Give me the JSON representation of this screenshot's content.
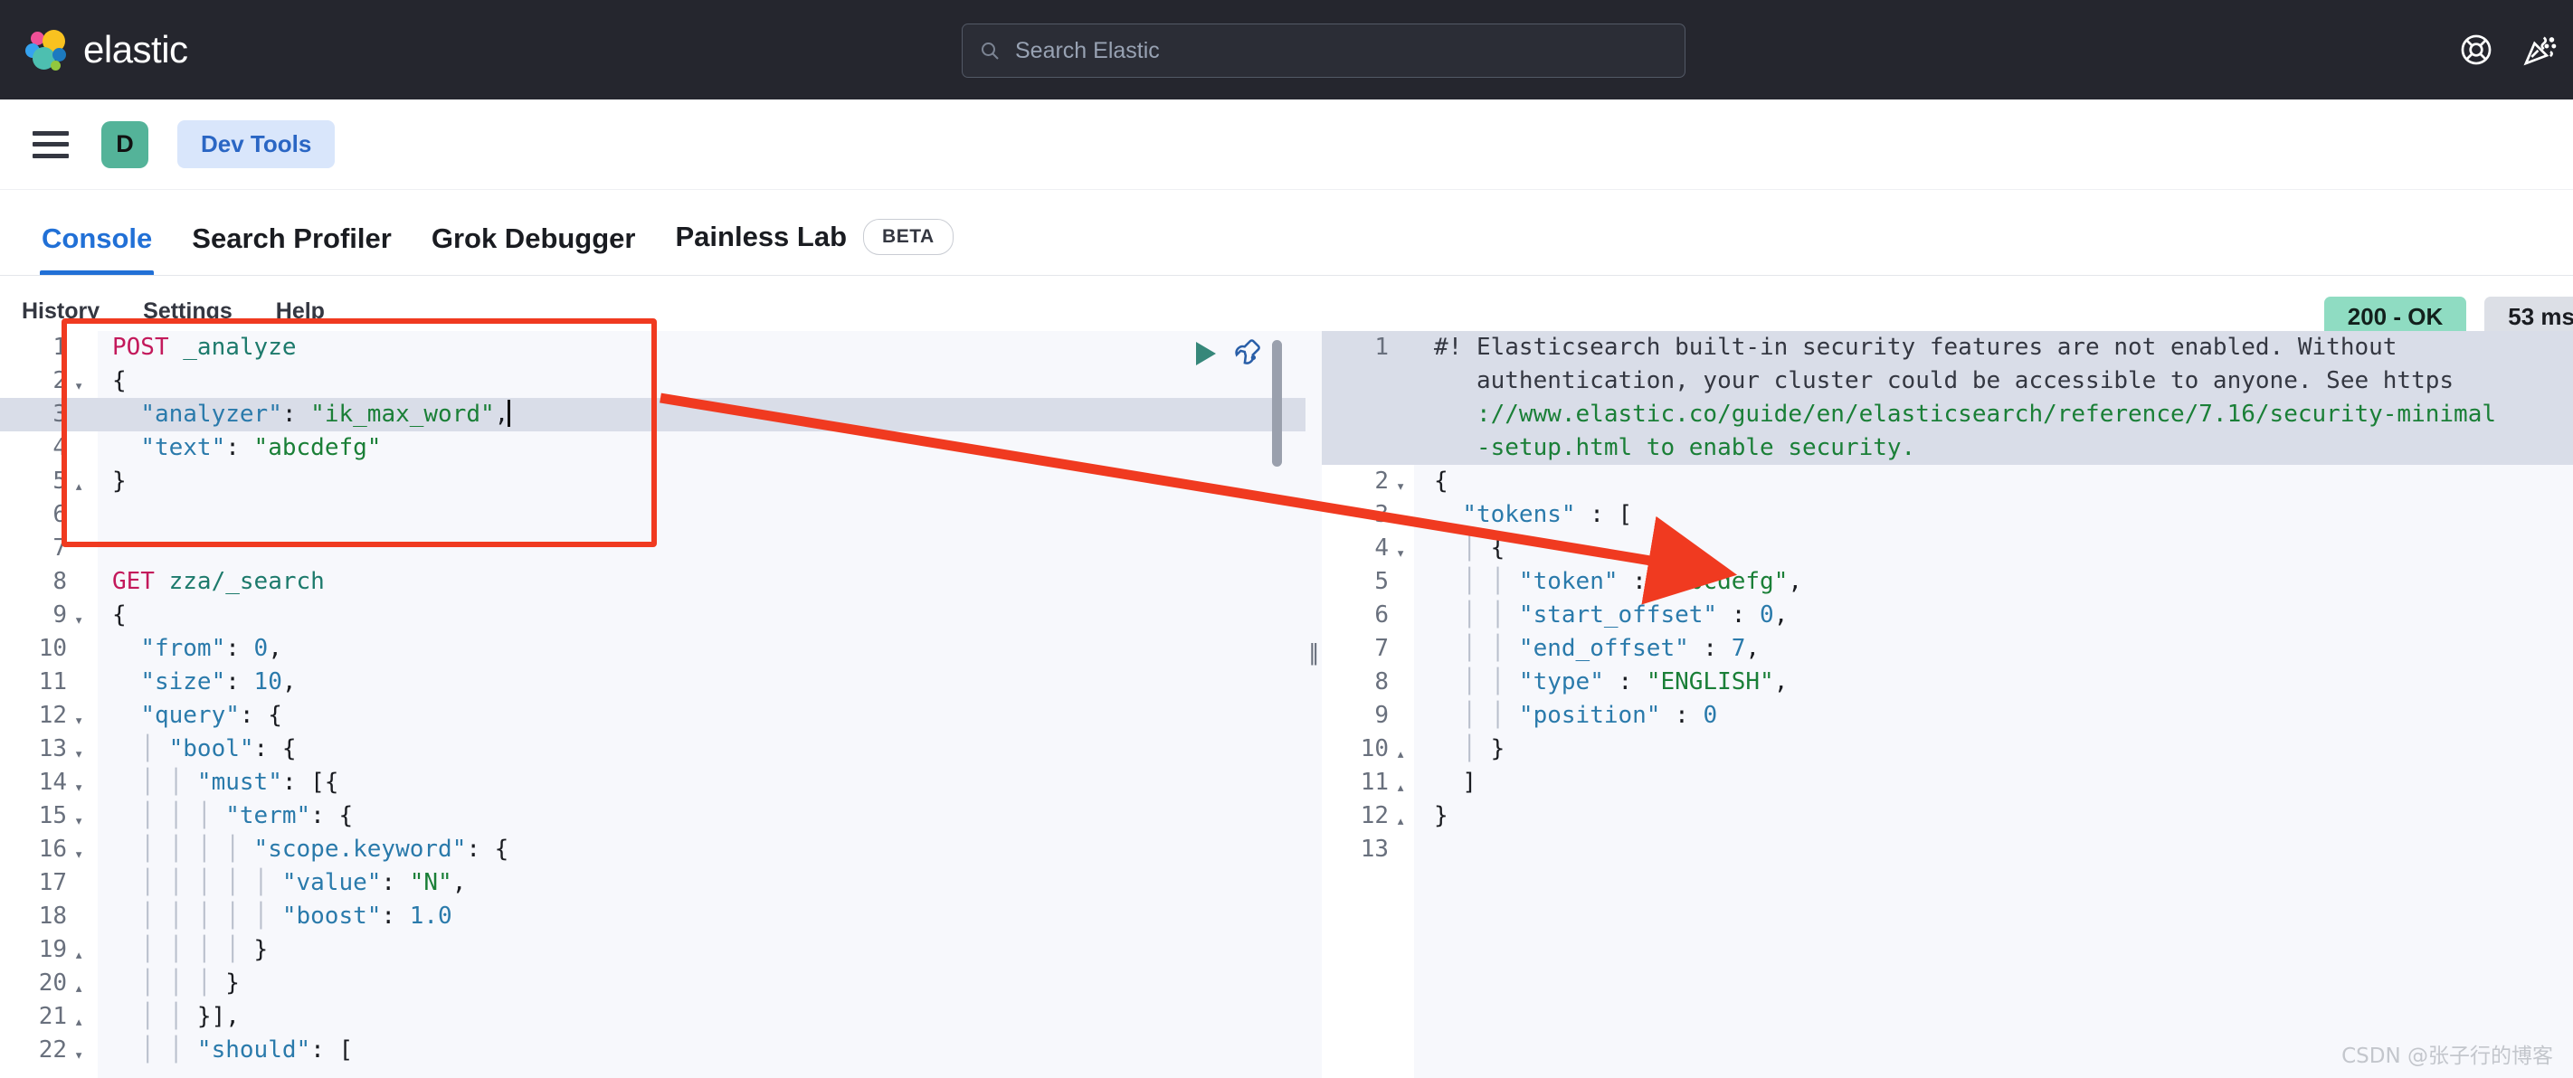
{
  "header": {
    "brand": "elastic",
    "logo_colors": {
      "pink": "#ee5097",
      "yellow": "#f9c220",
      "blue": "#36a2ef",
      "teal": "#4dbfb0",
      "navy": "#1c7ac0",
      "green": "#92c73e"
    },
    "background": "#25262e",
    "search_placeholder": "Search Elastic",
    "icons": [
      "help-lifebuoy-icon",
      "news-confetti-icon"
    ]
  },
  "breadcrumb": {
    "menu_icon": "hamburger-menu-icon",
    "space_initial": "D",
    "space_color": "#54b399",
    "crumb_label": "Dev Tools",
    "crumb_color": "#2a66c4"
  },
  "tabs": [
    {
      "label": "Console",
      "active": true
    },
    {
      "label": "Search Profiler",
      "active": false
    },
    {
      "label": "Grok Debugger",
      "active": false
    },
    {
      "label": "Painless Lab",
      "active": false,
      "badge": "BETA"
    }
  ],
  "console_menu": [
    {
      "label": "History"
    },
    {
      "label": "Settings"
    },
    {
      "label": "Help"
    }
  ],
  "status": {
    "code_label": "200 - OK",
    "code_color": "#8fdcc2",
    "time_label": "53 ms",
    "time_color": "#dcdfe6"
  },
  "actions": {
    "play_label": "play-request-button",
    "wrench_label": "wrench-actions-button"
  },
  "request_editor": {
    "lines": [
      {
        "n": "1",
        "fold": "",
        "highlight": false,
        "parts": [
          {
            "t": "POST ",
            "c": "tok-method"
          },
          {
            "t": "_analyze",
            "c": "tok-url"
          }
        ]
      },
      {
        "n": "2",
        "fold": "▾",
        "highlight": false,
        "parts": [
          {
            "t": "{",
            "c": "tok-punct"
          }
        ]
      },
      {
        "n": "3",
        "fold": "",
        "highlight": true,
        "caret": true,
        "parts": [
          {
            "t": "  ",
            "c": "tok-punct"
          },
          {
            "t": "\"analyzer\"",
            "c": "tok-key"
          },
          {
            "t": ": ",
            "c": "tok-punct"
          },
          {
            "t": "\"ik_max_word\"",
            "c": "tok-str"
          },
          {
            "t": ",",
            "c": "tok-punct"
          }
        ]
      },
      {
        "n": "4",
        "fold": "",
        "highlight": false,
        "parts": [
          {
            "t": "  ",
            "c": "tok-punct"
          },
          {
            "t": "\"text\"",
            "c": "tok-key"
          },
          {
            "t": ": ",
            "c": "tok-punct"
          },
          {
            "t": "\"abcdefg\"",
            "c": "tok-str"
          }
        ]
      },
      {
        "n": "5",
        "fold": "▴",
        "highlight": false,
        "parts": [
          {
            "t": "}",
            "c": "tok-punct"
          }
        ]
      },
      {
        "n": "6",
        "fold": "",
        "highlight": false,
        "parts": []
      },
      {
        "n": "7",
        "fold": "",
        "highlight": false,
        "parts": []
      },
      {
        "n": "8",
        "fold": "",
        "highlight": false,
        "parts": [
          {
            "t": "GET ",
            "c": "tok-method"
          },
          {
            "t": "zza/_search",
            "c": "tok-url"
          }
        ]
      },
      {
        "n": "9",
        "fold": "▾",
        "highlight": false,
        "parts": [
          {
            "t": "{",
            "c": "tok-punct"
          }
        ]
      },
      {
        "n": "10",
        "fold": "",
        "highlight": false,
        "parts": [
          {
            "t": "  ",
            "c": "tok-punct"
          },
          {
            "t": "\"from\"",
            "c": "tok-key"
          },
          {
            "t": ": ",
            "c": "tok-punct"
          },
          {
            "t": "0",
            "c": "tok-num"
          },
          {
            "t": ",",
            "c": "tok-punct"
          }
        ]
      },
      {
        "n": "11",
        "fold": "",
        "highlight": false,
        "parts": [
          {
            "t": "  ",
            "c": "tok-punct"
          },
          {
            "t": "\"size\"",
            "c": "tok-key"
          },
          {
            "t": ": ",
            "c": "tok-punct"
          },
          {
            "t": "10",
            "c": "tok-num"
          },
          {
            "t": ",",
            "c": "tok-punct"
          }
        ]
      },
      {
        "n": "12",
        "fold": "▾",
        "highlight": false,
        "parts": [
          {
            "t": "  ",
            "c": "tok-punct"
          },
          {
            "t": "\"query\"",
            "c": "tok-key"
          },
          {
            "t": ": {",
            "c": "tok-punct"
          }
        ]
      },
      {
        "n": "13",
        "fold": "▾",
        "highlight": false,
        "parts": [
          {
            "t": "  │ ",
            "c": "indent-guide"
          },
          {
            "t": "\"bool\"",
            "c": "tok-key"
          },
          {
            "t": ": {",
            "c": "tok-punct"
          }
        ]
      },
      {
        "n": "14",
        "fold": "▾",
        "highlight": false,
        "parts": [
          {
            "t": "  │ │ ",
            "c": "indent-guide"
          },
          {
            "t": "\"must\"",
            "c": "tok-key"
          },
          {
            "t": ": [{",
            "c": "tok-punct"
          }
        ]
      },
      {
        "n": "15",
        "fold": "▾",
        "highlight": false,
        "parts": [
          {
            "t": "  │ │ │ ",
            "c": "indent-guide"
          },
          {
            "t": "\"term\"",
            "c": "tok-key"
          },
          {
            "t": ": {",
            "c": "tok-punct"
          }
        ]
      },
      {
        "n": "16",
        "fold": "▾",
        "highlight": false,
        "parts": [
          {
            "t": "  │ │ │ │ ",
            "c": "indent-guide"
          },
          {
            "t": "\"scope.keyword\"",
            "c": "tok-key"
          },
          {
            "t": ": {",
            "c": "tok-punct"
          }
        ]
      },
      {
        "n": "17",
        "fold": "",
        "highlight": false,
        "parts": [
          {
            "t": "  │ │ │ │ │ ",
            "c": "indent-guide"
          },
          {
            "t": "\"value\"",
            "c": "tok-key"
          },
          {
            "t": ": ",
            "c": "tok-punct"
          },
          {
            "t": "\"N\"",
            "c": "tok-str"
          },
          {
            "t": ",",
            "c": "tok-punct"
          }
        ]
      },
      {
        "n": "18",
        "fold": "",
        "highlight": false,
        "parts": [
          {
            "t": "  │ │ │ │ │ ",
            "c": "indent-guide"
          },
          {
            "t": "\"boost\"",
            "c": "tok-key"
          },
          {
            "t": ": ",
            "c": "tok-punct"
          },
          {
            "t": "1.0",
            "c": "tok-num"
          }
        ]
      },
      {
        "n": "19",
        "fold": "▴",
        "highlight": false,
        "parts": [
          {
            "t": "  │ │ │ │ ",
            "c": "indent-guide"
          },
          {
            "t": "}",
            "c": "tok-punct"
          }
        ]
      },
      {
        "n": "20",
        "fold": "▴",
        "highlight": false,
        "parts": [
          {
            "t": "  │ │ │ ",
            "c": "indent-guide"
          },
          {
            "t": "}",
            "c": "tok-punct"
          }
        ]
      },
      {
        "n": "21",
        "fold": "▴",
        "highlight": false,
        "parts": [
          {
            "t": "  │ │ ",
            "c": "indent-guide"
          },
          {
            "t": "}],",
            "c": "tok-punct"
          }
        ]
      },
      {
        "n": "22",
        "fold": "▾",
        "highlight": false,
        "parts": [
          {
            "t": "  │ │ ",
            "c": "indent-guide"
          },
          {
            "t": "\"should\"",
            "c": "tok-key"
          },
          {
            "t": ": [",
            "c": "tok-punct"
          }
        ]
      }
    ]
  },
  "response_editor": {
    "error_marker": "✕",
    "lines": [
      {
        "n": "1",
        "fold": "",
        "highlight": true,
        "wrap": true,
        "parts": [
          {
            "t": "#! Elasticsearch built-in security features are not enabled. Without",
            "c": "tok-warn"
          }
        ]
      },
      {
        "n": "",
        "fold": "",
        "highlight": true,
        "wrap": true,
        "parts": [
          {
            "t": "   authentication, your cluster could be accessible to anyone. See https",
            "c": "tok-warn"
          }
        ]
      },
      {
        "n": "",
        "fold": "",
        "highlight": true,
        "wrap": true,
        "parts": [
          {
            "t": "   ://www.elastic.co/guide/en/elasticsearch/reference/7.16/security-minimal",
            "c": "tok-str"
          }
        ]
      },
      {
        "n": "",
        "fold": "",
        "highlight": true,
        "wrap": true,
        "parts": [
          {
            "t": "   -setup.html to enable security.",
            "c": "tok-str"
          }
        ]
      },
      {
        "n": "2",
        "fold": "▾",
        "highlight": false,
        "parts": [
          {
            "t": "{",
            "c": "tok-punct"
          }
        ]
      },
      {
        "n": "3",
        "fold": "▾",
        "highlight": false,
        "parts": [
          {
            "t": "  ",
            "c": "tok-punct"
          },
          {
            "t": "\"tokens\"",
            "c": "tok-key"
          },
          {
            "t": " : [",
            "c": "tok-punct"
          }
        ]
      },
      {
        "n": "4",
        "fold": "▾",
        "highlight": false,
        "parts": [
          {
            "t": "  │ ",
            "c": "indent-guide"
          },
          {
            "t": "{",
            "c": "tok-punct"
          }
        ]
      },
      {
        "n": "5",
        "fold": "",
        "highlight": false,
        "parts": [
          {
            "t": "  │ │ ",
            "c": "indent-guide"
          },
          {
            "t": "\"token\"",
            "c": "tok-key"
          },
          {
            "t": " : ",
            "c": "tok-punct"
          },
          {
            "t": "\"abcdefg\"",
            "c": "tok-str"
          },
          {
            "t": ",",
            "c": "tok-punct"
          }
        ]
      },
      {
        "n": "6",
        "fold": "",
        "highlight": false,
        "parts": [
          {
            "t": "  │ │ ",
            "c": "indent-guide"
          },
          {
            "t": "\"start_offset\"",
            "c": "tok-key"
          },
          {
            "t": " : ",
            "c": "tok-punct"
          },
          {
            "t": "0",
            "c": "tok-num"
          },
          {
            "t": ",",
            "c": "tok-punct"
          }
        ]
      },
      {
        "n": "7",
        "fold": "",
        "highlight": false,
        "parts": [
          {
            "t": "  │ │ ",
            "c": "indent-guide"
          },
          {
            "t": "\"end_offset\"",
            "c": "tok-key"
          },
          {
            "t": " : ",
            "c": "tok-punct"
          },
          {
            "t": "7",
            "c": "tok-num"
          },
          {
            "t": ",",
            "c": "tok-punct"
          }
        ]
      },
      {
        "n": "8",
        "fold": "",
        "highlight": false,
        "parts": [
          {
            "t": "  │ │ ",
            "c": "indent-guide"
          },
          {
            "t": "\"type\"",
            "c": "tok-key"
          },
          {
            "t": " : ",
            "c": "tok-punct"
          },
          {
            "t": "\"ENGLISH\"",
            "c": "tok-str"
          },
          {
            "t": ",",
            "c": "tok-punct"
          }
        ]
      },
      {
        "n": "9",
        "fold": "",
        "highlight": false,
        "parts": [
          {
            "t": "  │ │ ",
            "c": "indent-guide"
          },
          {
            "t": "\"position\"",
            "c": "tok-key"
          },
          {
            "t": " : ",
            "c": "tok-punct"
          },
          {
            "t": "0",
            "c": "tok-num"
          }
        ]
      },
      {
        "n": "10",
        "fold": "▴",
        "highlight": false,
        "parts": [
          {
            "t": "  │ ",
            "c": "indent-guide"
          },
          {
            "t": "}",
            "c": "tok-punct"
          }
        ]
      },
      {
        "n": "11",
        "fold": "▴",
        "highlight": false,
        "parts": [
          {
            "t": "  ",
            "c": "tok-punct"
          },
          {
            "t": "]",
            "c": "tok-punct"
          }
        ]
      },
      {
        "n": "12",
        "fold": "▴",
        "highlight": false,
        "parts": [
          {
            "t": "}",
            "c": "tok-punct"
          }
        ]
      },
      {
        "n": "13",
        "fold": "",
        "highlight": false,
        "parts": []
      }
    ]
  },
  "annotations": {
    "box_color": "#f03a20",
    "arrow_color": "#f03a20"
  },
  "watermark": "CSDN @张子行的博客"
}
